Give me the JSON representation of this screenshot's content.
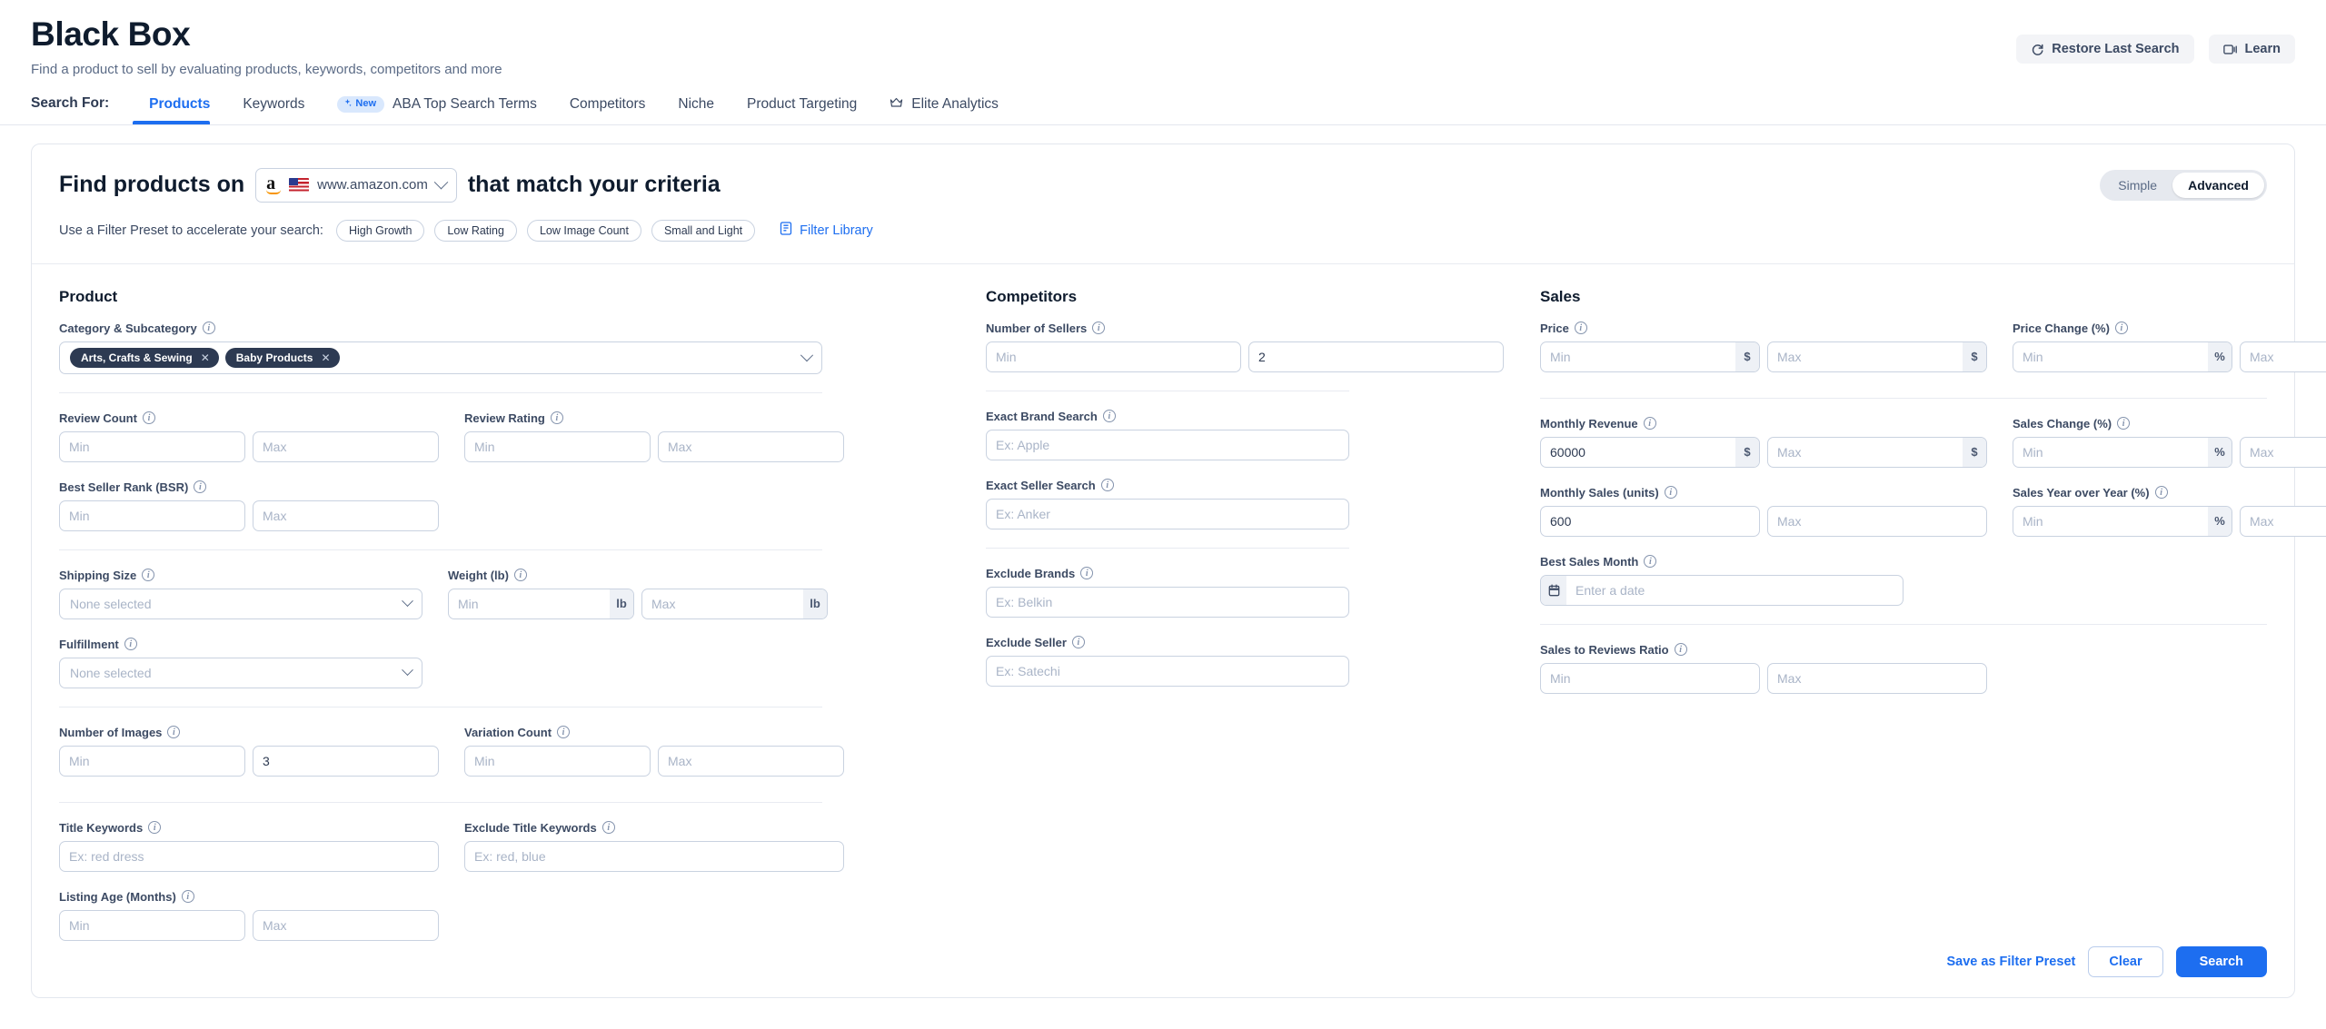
{
  "header": {
    "title": "Black Box",
    "subtitle": "Find a product to sell by evaluating products, keywords, competitors and more",
    "restore_label": "Restore Last Search",
    "learn_label": "Learn"
  },
  "tabs": {
    "search_for_label": "Search For:",
    "items": [
      {
        "label": "Products",
        "active": true,
        "badge": null,
        "icon": null
      },
      {
        "label": "Keywords",
        "active": false,
        "badge": null,
        "icon": null
      },
      {
        "label": "ABA Top Search Terms",
        "active": false,
        "badge": "New",
        "icon": "sparkle-icon"
      },
      {
        "label": "Competitors",
        "active": false,
        "badge": null,
        "icon": null
      },
      {
        "label": "Niche",
        "active": false,
        "badge": null,
        "icon": null
      },
      {
        "label": "Product Targeting",
        "active": false,
        "badge": null,
        "icon": null
      },
      {
        "label": "Elite Analytics",
        "active": false,
        "badge": null,
        "icon": "crown-icon"
      }
    ]
  },
  "card": {
    "find_prefix": "Find products on",
    "find_suffix": "that match your criteria",
    "marketplace": "www.amazon.com",
    "preset_label": "Use a Filter Preset to accelerate your search:",
    "presets": [
      "High Growth",
      "Low Rating",
      "Low Image Count",
      "Small and Light"
    ],
    "filter_library_label": "Filter Library",
    "mode": {
      "simple": "Simple",
      "advanced": "Advanced",
      "selected": "Advanced"
    }
  },
  "product": {
    "title": "Product",
    "category": {
      "label": "Category & Subcategory",
      "tags": [
        "Arts, Crafts & Sewing",
        "Baby Products"
      ]
    },
    "review_count": {
      "label": "Review Count",
      "min": "",
      "max": "",
      "min_ph": "Min",
      "max_ph": "Max"
    },
    "review_rating": {
      "label": "Review Rating",
      "min": "",
      "max": "",
      "min_ph": "Min",
      "max_ph": "Max"
    },
    "bsr": {
      "label": "Best Seller Rank (BSR)",
      "min": "",
      "max": "",
      "min_ph": "Min",
      "max_ph": "Max"
    },
    "shipping_size": {
      "label": "Shipping Size",
      "value": "None selected"
    },
    "weight": {
      "label": "Weight (lb)",
      "min": "",
      "max": "",
      "min_ph": "Min",
      "max_ph": "Max",
      "unit": "lb"
    },
    "fulfillment": {
      "label": "Fulfillment",
      "value": "None selected"
    },
    "number_of_images": {
      "label": "Number of Images",
      "min": "",
      "max": "3",
      "min_ph": "Min",
      "max_ph": "Max"
    },
    "variation_count": {
      "label": "Variation Count",
      "min": "",
      "max": "",
      "min_ph": "Min",
      "max_ph": "Max"
    },
    "title_keywords": {
      "label": "Title Keywords",
      "value": "",
      "placeholder": "Ex: red dress"
    },
    "exclude_title_keywords": {
      "label": "Exclude Title Keywords",
      "value": "",
      "placeholder": "Ex: red, blue"
    },
    "listing_age": {
      "label": "Listing Age (Months)",
      "min": "",
      "max": "",
      "min_ph": "Min",
      "max_ph": "Max"
    }
  },
  "competitors": {
    "title": "Competitors",
    "number_of_sellers": {
      "label": "Number of Sellers",
      "min": "",
      "max": "2",
      "min_ph": "Min",
      "max_ph": "Max"
    },
    "exact_brand_search": {
      "label": "Exact Brand Search",
      "value": "",
      "placeholder": "Ex: Apple"
    },
    "exact_seller_search": {
      "label": "Exact Seller Search",
      "value": "",
      "placeholder": "Ex: Anker"
    },
    "exclude_brands": {
      "label": "Exclude Brands",
      "value": "",
      "placeholder": "Ex: Belkin"
    },
    "exclude_seller": {
      "label": "Exclude Seller",
      "value": "",
      "placeholder": "Ex: Satechi"
    }
  },
  "sales": {
    "title": "Sales",
    "price": {
      "label": "Price",
      "min": "",
      "max": "",
      "min_ph": "Min",
      "max_ph": "Max",
      "unit": "$"
    },
    "price_change": {
      "label": "Price Change (%)",
      "min": "",
      "max": "",
      "min_ph": "Min",
      "max_ph": "Max",
      "unit": "%"
    },
    "monthly_revenue": {
      "label": "Monthly Revenue",
      "min": "60000",
      "max": "",
      "min_ph": "Min",
      "max_ph": "Max",
      "unit": "$"
    },
    "sales_change": {
      "label": "Sales Change (%)",
      "min": "",
      "max": "",
      "min_ph": "Min",
      "max_ph": "Max",
      "unit": "%"
    },
    "monthly_sales": {
      "label": "Monthly Sales (units)",
      "min": "600",
      "max": "",
      "min_ph": "Min",
      "max_ph": "Max"
    },
    "sales_yoy": {
      "label": "Sales Year over Year (%)",
      "min": "",
      "max": "",
      "min_ph": "Min",
      "max_ph": "Max",
      "unit": "%"
    },
    "best_sales_month": {
      "label": "Best Sales Month",
      "value": "",
      "placeholder": "Enter a date"
    },
    "sales_to_reviews": {
      "label": "Sales to Reviews Ratio",
      "min": "",
      "max": "",
      "min_ph": "Min",
      "max_ph": "Max"
    }
  },
  "footer": {
    "save_preset": "Save as Filter Preset",
    "clear": "Clear",
    "search": "Search"
  },
  "colors": {
    "accent": "#1d6ef0",
    "tag_bg": "#2d3a52",
    "border": "#c9d2e0",
    "text": "#2d3a52"
  }
}
